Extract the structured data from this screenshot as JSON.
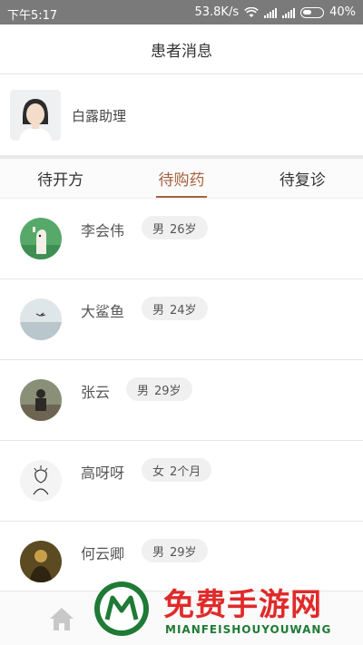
{
  "status_bar": {
    "time": "下午5:17",
    "net_speed": "53.8K/s",
    "battery": "40%"
  },
  "header": {
    "title": "患者消息"
  },
  "assistant": {
    "name": "白露助理"
  },
  "tabs": [
    {
      "label": "待开方",
      "active": false
    },
    {
      "label": "待购药",
      "active": true
    },
    {
      "label": "待复诊",
      "active": false
    }
  ],
  "patients": [
    {
      "name": "李会伟",
      "gender": "男",
      "age": "26岁"
    },
    {
      "name": "大鲨鱼",
      "gender": "男",
      "age": "24岁"
    },
    {
      "name": "张云",
      "gender": "男",
      "age": "29岁"
    },
    {
      "name": "高呀呀",
      "gender": "女",
      "age": "2个月"
    },
    {
      "name": "何云卿",
      "gender": "男",
      "age": "29岁"
    }
  ],
  "watermark": {
    "title": "免费手游网",
    "subtitle": "MIANFEISHOUYOUWANG"
  },
  "colors": {
    "accent": "#a5613d",
    "statusbar": "#7a7a7a",
    "watermark_red": "#e02a2a",
    "watermark_green": "#1f7a35"
  }
}
